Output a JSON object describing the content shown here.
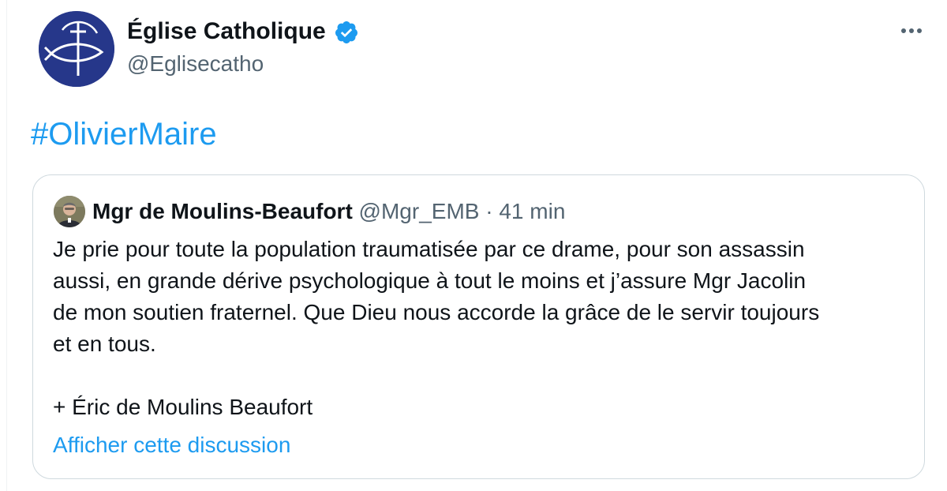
{
  "tweet": {
    "author": {
      "name": "Église Catholique",
      "handle": "@Eglisecatho",
      "verified": true,
      "avatar_icon": "church-cross-logo-icon"
    },
    "more_icon": "more-horizontal-icon",
    "hashtag": "#OlivierMaire"
  },
  "quoted_tweet": {
    "author": {
      "name": "Mgr de Moulins-Beaufort",
      "handle": "@Mgr_EMB",
      "avatar_icon": "profile-photo-icon"
    },
    "separator": "·",
    "time": "41 min",
    "text_lines": [
      "Je prie pour toute la population traumatisée par ce drame, pour son assassin",
      "aussi, en grande dérive psychologique à tout le moins et j’assure Mgr Jacolin",
      "de mon soutien fraternel. Que Dieu nous accorde la grâce de le servir toujours",
      "et en tous.",
      "",
      "+ Éric de Moulins Beaufort"
    ],
    "show_thread": "Afficher cette discussion"
  },
  "colors": {
    "link": "#1d9bf0",
    "verified": "#1d9bf0",
    "secondary_text": "#536471",
    "avatar_bg": "#26378a",
    "card_border": "#cfd9de"
  }
}
